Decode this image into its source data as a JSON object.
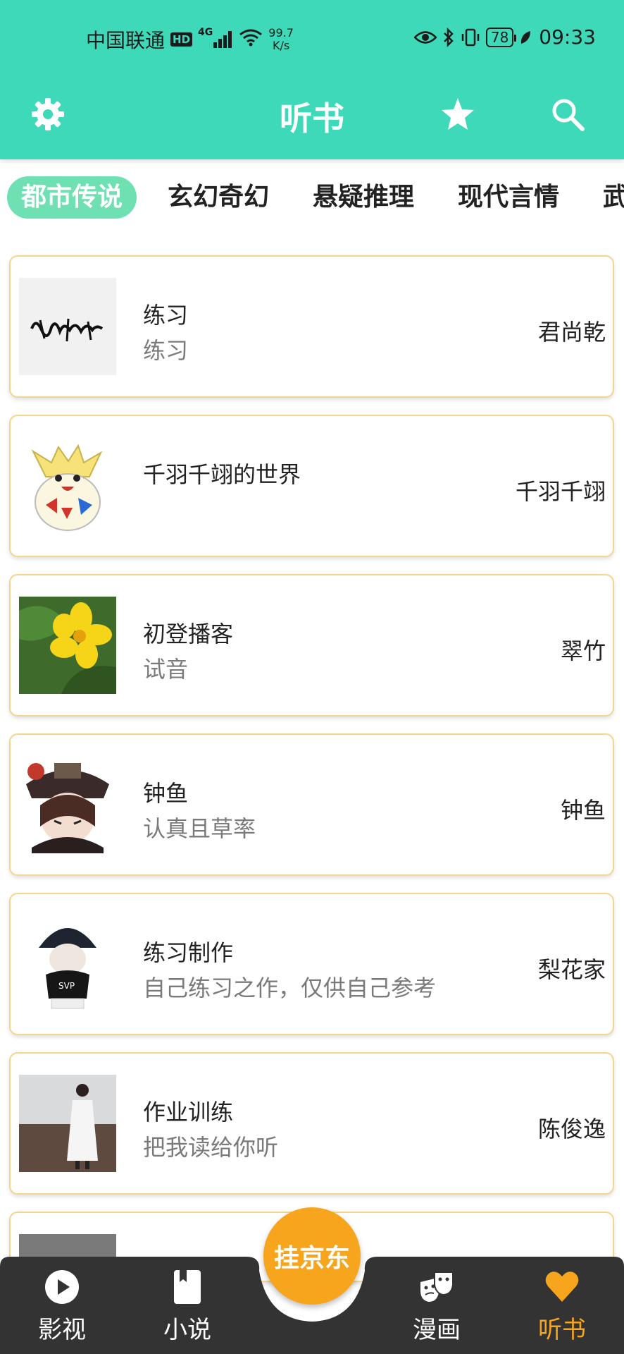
{
  "status_bar": {
    "carrier": "中国联通",
    "hd": "HD",
    "network": "4G",
    "speed_value": "99.7",
    "speed_unit": "K/s",
    "battery": "78",
    "time": "09:33"
  },
  "toolbar": {
    "title": "听书",
    "settings_icon": "gear-icon",
    "favorite_icon": "star-icon",
    "search_icon": "search-icon"
  },
  "tabs": [
    {
      "label": "都市传说",
      "active": true
    },
    {
      "label": "玄幻奇幻",
      "active": false
    },
    {
      "label": "悬疑推理",
      "active": false
    },
    {
      "label": "现代言情",
      "active": false
    },
    {
      "label": "武",
      "active": false
    }
  ],
  "cards": [
    {
      "title": "练习",
      "subtitle": "练习",
      "author": "君尚乾",
      "thumb": "calligraphy"
    },
    {
      "title": "千羽千翊的世界",
      "subtitle": "",
      "author": "千羽千翊",
      "thumb": "cartoon-egg"
    },
    {
      "title": "初登播客",
      "subtitle": "试音",
      "author": "翠竹",
      "thumb": "yellow-flower"
    },
    {
      "title": "钟鱼",
      "subtitle": "认真且草率",
      "author": "钟鱼",
      "thumb": "anime-girl"
    },
    {
      "title": "练习制作",
      "subtitle": "自己练习之作，仅供自己参考",
      "author": "梨花家",
      "thumb": "hat-figure"
    },
    {
      "title": "作业训练",
      "subtitle": "把我读给你听",
      "author": "陈俊逸",
      "thumb": "person-photo"
    }
  ],
  "nav": {
    "items": [
      {
        "label": "影视",
        "icon": "play-icon",
        "active": false
      },
      {
        "label": "小说",
        "icon": "book-icon",
        "active": false
      },
      {
        "label": "漫画",
        "icon": "masks-icon",
        "active": false
      },
      {
        "label": "听书",
        "icon": "heart-icon",
        "active": true
      }
    ],
    "center_button": "挂京东"
  },
  "colors": {
    "header": "#3dd9b8",
    "tab_active": "#6fe0b2",
    "card_border": "#f4d58d",
    "accent": "#f7a51c",
    "nav_bg": "#333333"
  }
}
